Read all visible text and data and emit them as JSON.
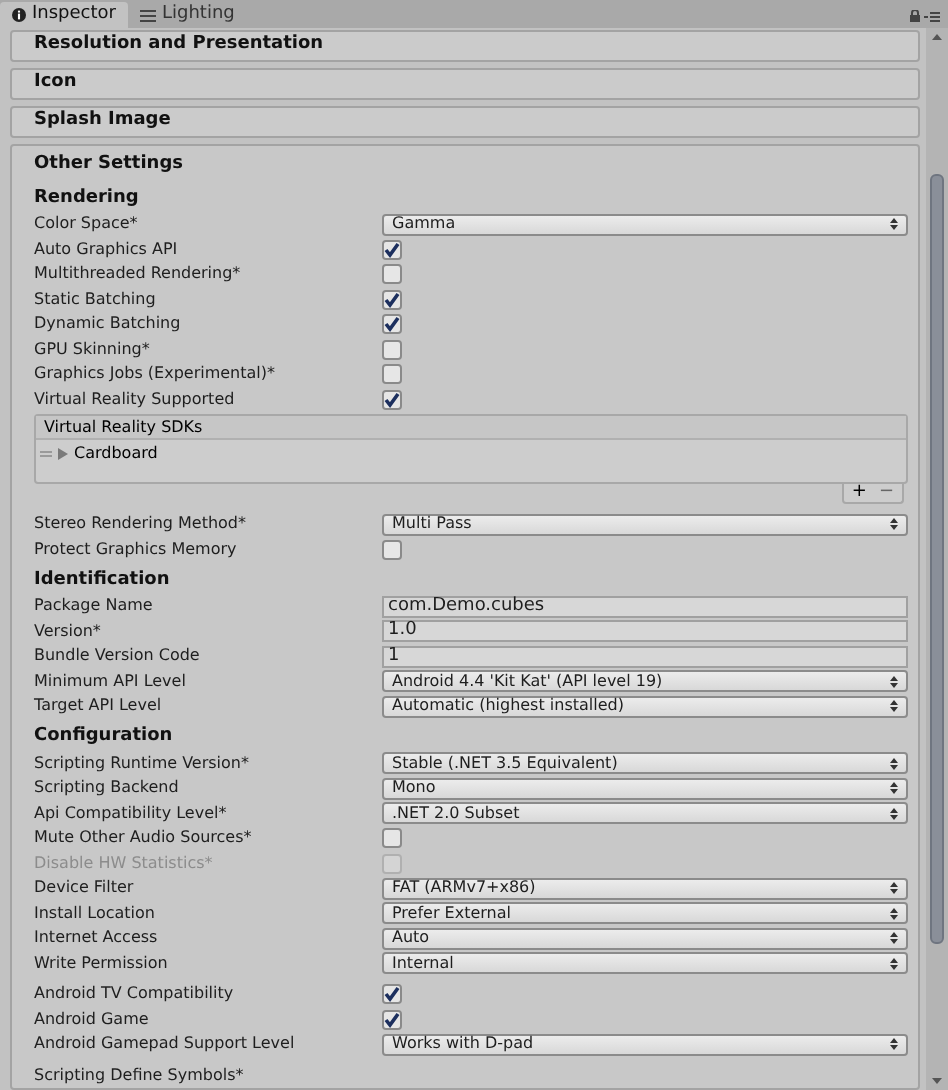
{
  "tabs": [
    {
      "label": "Inspector",
      "selected": true
    },
    {
      "label": "Lighting",
      "selected": false
    }
  ],
  "foldouts": [
    {
      "title": "Resolution and Presentation"
    },
    {
      "title": "Icon"
    },
    {
      "title": "Splash Image"
    }
  ],
  "other_settings": {
    "title": "Other Settings",
    "sections": [
      {
        "heading": "Rendering",
        "rows": [
          {
            "kind": "dropdown",
            "label": "Color Space*",
            "value": "Gamma"
          },
          {
            "kind": "checkbox",
            "label": "Auto Graphics API",
            "checked": true,
            "disabled": false
          },
          {
            "kind": "checkbox",
            "label": "Multithreaded Rendering*",
            "checked": false,
            "disabled": false
          },
          {
            "kind": "checkbox",
            "label": "Static Batching",
            "checked": true,
            "disabled": false
          },
          {
            "kind": "checkbox",
            "label": "Dynamic Batching",
            "checked": true,
            "disabled": false
          },
          {
            "kind": "checkbox",
            "label": "GPU Skinning*",
            "checked": false,
            "disabled": false
          },
          {
            "kind": "checkbox",
            "label": "Graphics Jobs (Experimental)*",
            "checked": false,
            "disabled": false
          },
          {
            "kind": "checkbox",
            "label": "Virtual Reality Supported",
            "checked": true,
            "disabled": false
          },
          {
            "kind": "list",
            "label": "Virtual Reality SDKs",
            "items": [
              "Cardboard"
            ],
            "add": "+",
            "remove": "−"
          },
          {
            "kind": "dropdown",
            "label": "Stereo Rendering Method*",
            "value": "Multi Pass"
          },
          {
            "kind": "checkbox",
            "label": "Protect Graphics Memory",
            "checked": false,
            "disabled": false
          }
        ]
      },
      {
        "heading": "Identification",
        "rows": [
          {
            "kind": "text",
            "label": "Package Name",
            "value": "com.Demo.cubes"
          },
          {
            "kind": "text",
            "label": "Version*",
            "value": "1.0"
          },
          {
            "kind": "text",
            "label": "Bundle Version Code",
            "value": "1"
          },
          {
            "kind": "dropdown",
            "label": "Minimum API Level",
            "value": "Android 4.4 'Kit Kat' (API level 19)"
          },
          {
            "kind": "dropdown",
            "label": "Target API Level",
            "value": "Automatic (highest installed)"
          }
        ]
      },
      {
        "heading": "Configuration",
        "rows": [
          {
            "kind": "dropdown",
            "label": "Scripting Runtime Version*",
            "value": "Stable (.NET 3.5 Equivalent)"
          },
          {
            "kind": "dropdown",
            "label": "Scripting Backend",
            "value": "Mono"
          },
          {
            "kind": "dropdown",
            "label": "Api Compatibility Level*",
            "value": ".NET 2.0 Subset"
          },
          {
            "kind": "checkbox",
            "label": "Mute Other Audio Sources*",
            "checked": false,
            "disabled": false
          },
          {
            "kind": "checkbox",
            "label": "Disable HW Statistics*",
            "checked": false,
            "disabled": true
          },
          {
            "kind": "dropdown",
            "label": "Device Filter",
            "value": "FAT (ARMv7+x86)"
          },
          {
            "kind": "dropdown",
            "label": "Install Location",
            "value": "Prefer External"
          },
          {
            "kind": "dropdown",
            "label": "Internet Access",
            "value": "Auto"
          },
          {
            "kind": "dropdown",
            "label": "Write Permission",
            "value": "Internal"
          }
        ]
      },
      {
        "rows": [
          {
            "kind": "checkbox",
            "label": "Android TV Compatibility",
            "checked": true,
            "disabled": false
          },
          {
            "kind": "checkbox",
            "label": "Android Game",
            "checked": true,
            "disabled": false
          },
          {
            "kind": "dropdown",
            "label": "Android Gamepad Support Level",
            "value": "Works with D-pad"
          }
        ]
      },
      {
        "rows": [
          {
            "kind": "label",
            "label": "Scripting Define Symbols*"
          }
        ]
      }
    ]
  }
}
